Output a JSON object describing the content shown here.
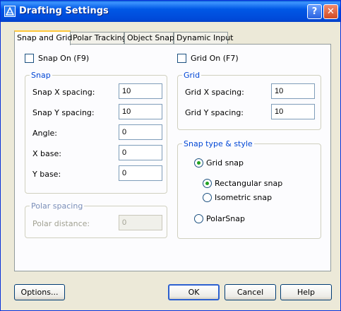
{
  "window": {
    "title": "Drafting Settings",
    "help_glyph": "?",
    "close_glyph": "✕"
  },
  "tabs": [
    {
      "label": "Snap and Grid",
      "active": true
    },
    {
      "label": "Polar Tracking",
      "active": false
    },
    {
      "label": "Object Snap",
      "active": false
    },
    {
      "label": "Dynamic Input",
      "active": false
    }
  ],
  "snap_on": {
    "label": "Snap On (F9)",
    "checked": false
  },
  "grid_on": {
    "label": "Grid On (F7)",
    "checked": false
  },
  "snap_group": {
    "title": "Snap",
    "x_spacing": {
      "label": "Snap X spacing:",
      "value": "10"
    },
    "y_spacing": {
      "label": "Snap Y spacing:",
      "value": "10"
    },
    "angle": {
      "label": "Angle:",
      "value": "0"
    },
    "x_base": {
      "label": "X base:",
      "value": "0"
    },
    "y_base": {
      "label": "Y base:",
      "value": "0"
    }
  },
  "polar_group": {
    "title": "Polar spacing",
    "distance": {
      "label": "Polar distance:",
      "value": "0"
    }
  },
  "grid_group": {
    "title": "Grid",
    "x_spacing": {
      "label": "Grid X spacing:",
      "value": "10"
    },
    "y_spacing": {
      "label": "Grid Y spacing:",
      "value": "10"
    }
  },
  "snap_type_group": {
    "title": "Snap type & style",
    "grid_snap": {
      "label": "Grid snap",
      "selected": true
    },
    "rectangular": {
      "label": "Rectangular snap",
      "selected": true
    },
    "isometric": {
      "label": "Isometric snap",
      "selected": false
    },
    "polarsnap": {
      "label": "PolarSnap",
      "selected": false
    }
  },
  "buttons": {
    "options": "Options...",
    "ok": "OK",
    "cancel": "Cancel",
    "help": "Help"
  },
  "colors": {
    "titlebar": "#0054e3",
    "group_title": "#0046d5",
    "tab_highlight": "#ffc83c",
    "radio_dot": "#21a121"
  }
}
